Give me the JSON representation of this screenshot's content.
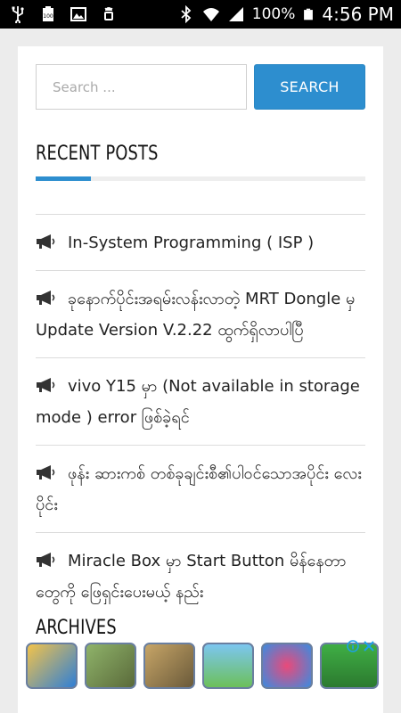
{
  "status_bar": {
    "battery_percent": "100%",
    "time": "4:56 PM",
    "left_icons": [
      "usb-icon",
      "battery-level-icon",
      "image-icon",
      "android-debug-icon"
    ],
    "right_icons": [
      "bluetooth-icon",
      "wifi-icon",
      "signal-icon",
      "battery-icon"
    ]
  },
  "search": {
    "placeholder": "Search ...",
    "button_label": "SEARCH"
  },
  "recent_posts": {
    "title": "RECENT POSTS",
    "accent_color": "#2d8ecf",
    "icon": "megaphone-icon",
    "items": [
      {
        "label": "In-System Programming ( ISP )"
      },
      {
        "label": "ခုနောက်ပိုင်းအရမ်းလန်းလာတဲ့ MRT Dongle မှ Update Version V.2.22 ထွက်ရှိလာပါပြီ"
      },
      {
        "label": "vivo Y15 မှာ (Not available in storage mode ) error ဖြစ်ခဲ့ရင်"
      },
      {
        "label": "ဖုန်း ဆားကစ် တစ်ခုချင်းစီ၏ပါဝင်သောအပိုင်း လေးပိုင်း"
      },
      {
        "label": "Miracle Box မှာ Start Button မိန်နေတာတွေကို ဖြေရှင်းပေးမယ့် နည်း"
      }
    ]
  },
  "archives": {
    "title": "ARCHIVES"
  },
  "ad_banner": {
    "tiles": [
      "subway-runner-game-icon",
      "tank-game-icon",
      "soldier-game-icon",
      "platformer-game-icon",
      "candy-game-icon",
      "soccer-game-icon"
    ],
    "info_icon": "ad-info-icon",
    "close_icon": "ad-close-icon",
    "accent_color": "#1da1e8"
  }
}
